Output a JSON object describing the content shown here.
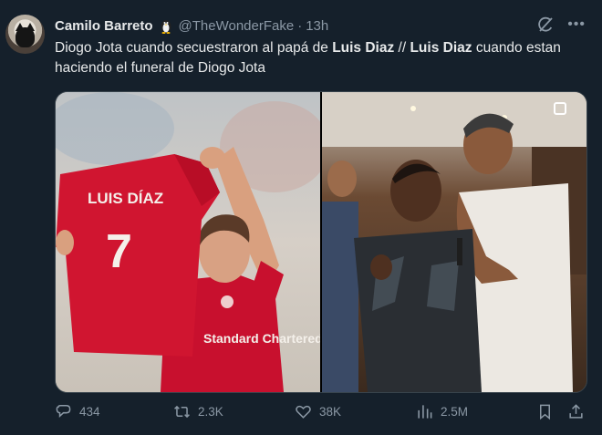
{
  "author": {
    "name": "Camilo Barreto",
    "handle": "@TheWonderFake",
    "separator": "·",
    "time": "13h"
  },
  "tweet_text": {
    "part1": "Diogo Jota cuando secuestraron al papá de ",
    "bold1": "Luis Diaz",
    "part2": " // ",
    "bold2": "Luis Diaz",
    "part3": " cuando estan haciendo el funeral de Diogo Jota"
  },
  "media": {
    "left_image": {
      "jersey_name": "LUIS DÍAZ",
      "jersey_number": "7",
      "sponsor": "Standard Chartered"
    },
    "right_image": {}
  },
  "actions": {
    "replies": "434",
    "reposts": "2.3K",
    "likes": "38K",
    "views": "2.5M"
  },
  "icons": {
    "reply": "reply-icon",
    "repost": "repost-icon",
    "like": "like-icon",
    "views": "views-icon",
    "bookmark": "bookmark-icon",
    "share": "share-icon",
    "grok": "grok-icon",
    "more": "more-icon"
  },
  "colors": {
    "background": "#15202b",
    "text": "#e7e9ea",
    "muted": "#8b98a5",
    "border": "#38444d",
    "jersey_red": "#c8102e"
  }
}
